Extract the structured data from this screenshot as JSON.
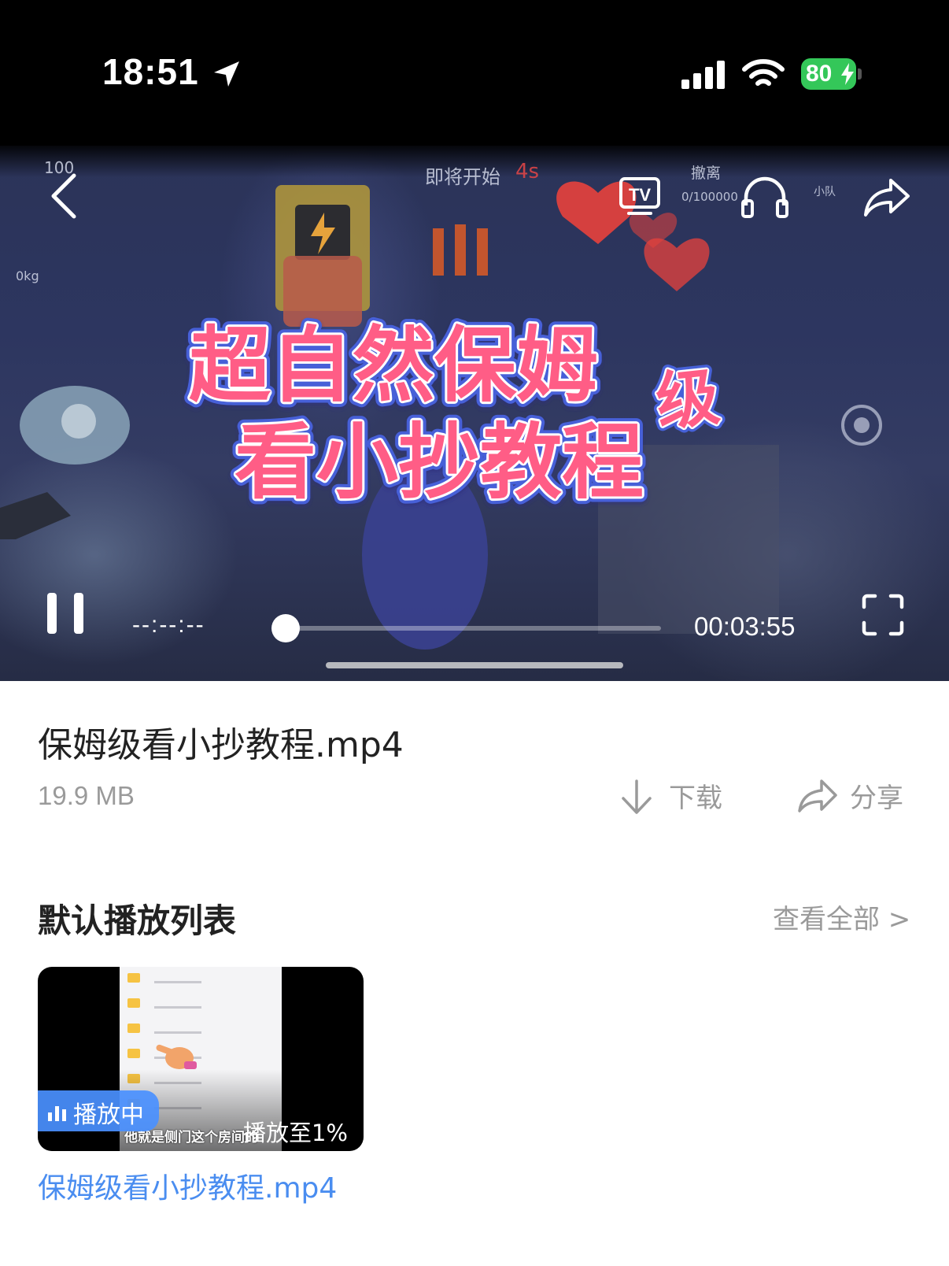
{
  "status_bar": {
    "time": "18:51",
    "battery": "80",
    "location_icon": "location-arrow-icon",
    "signal_icon": "cellular-signal-icon",
    "wifi_icon": "wifi-icon",
    "battery_color": "#34c759"
  },
  "player": {
    "icons": {
      "back": "chevron-left-icon",
      "tv": "tv-cast-icon",
      "audio": "headphones-icon",
      "share": "share-arrow-icon",
      "pause": "pause-icon",
      "fullscreen": "fullscreen-icon"
    },
    "title_art_line1": "超自然保姆",
    "title_art_badge": "级",
    "title_art_line2": "看小抄教程",
    "game_hud": {
      "countdown": "即将开始",
      "countdown_seconds": "4s",
      "evacuate": "撤离",
      "evacuate_value": "0/100000",
      "team": "小队",
      "hp": "100",
      "weight": "0kg"
    },
    "elapsed": "--:--:--",
    "duration": "00:03:55",
    "progress": 0.0,
    "tv_label": "TV"
  },
  "file": {
    "name": "保姆级看小抄教程.mp4",
    "size": "19.9 MB",
    "download_label": "下载",
    "share_label": "分享"
  },
  "playlist": {
    "title": "默认播放列表",
    "see_all": "查看全部 >",
    "items": [
      {
        "title": "保姆级看小抄教程.mp4",
        "badge": "播放中",
        "progress_text": "播放至1%",
        "subtitle": "他就是侧门这个房间的",
        "accent": "#4a8df0"
      }
    ]
  }
}
